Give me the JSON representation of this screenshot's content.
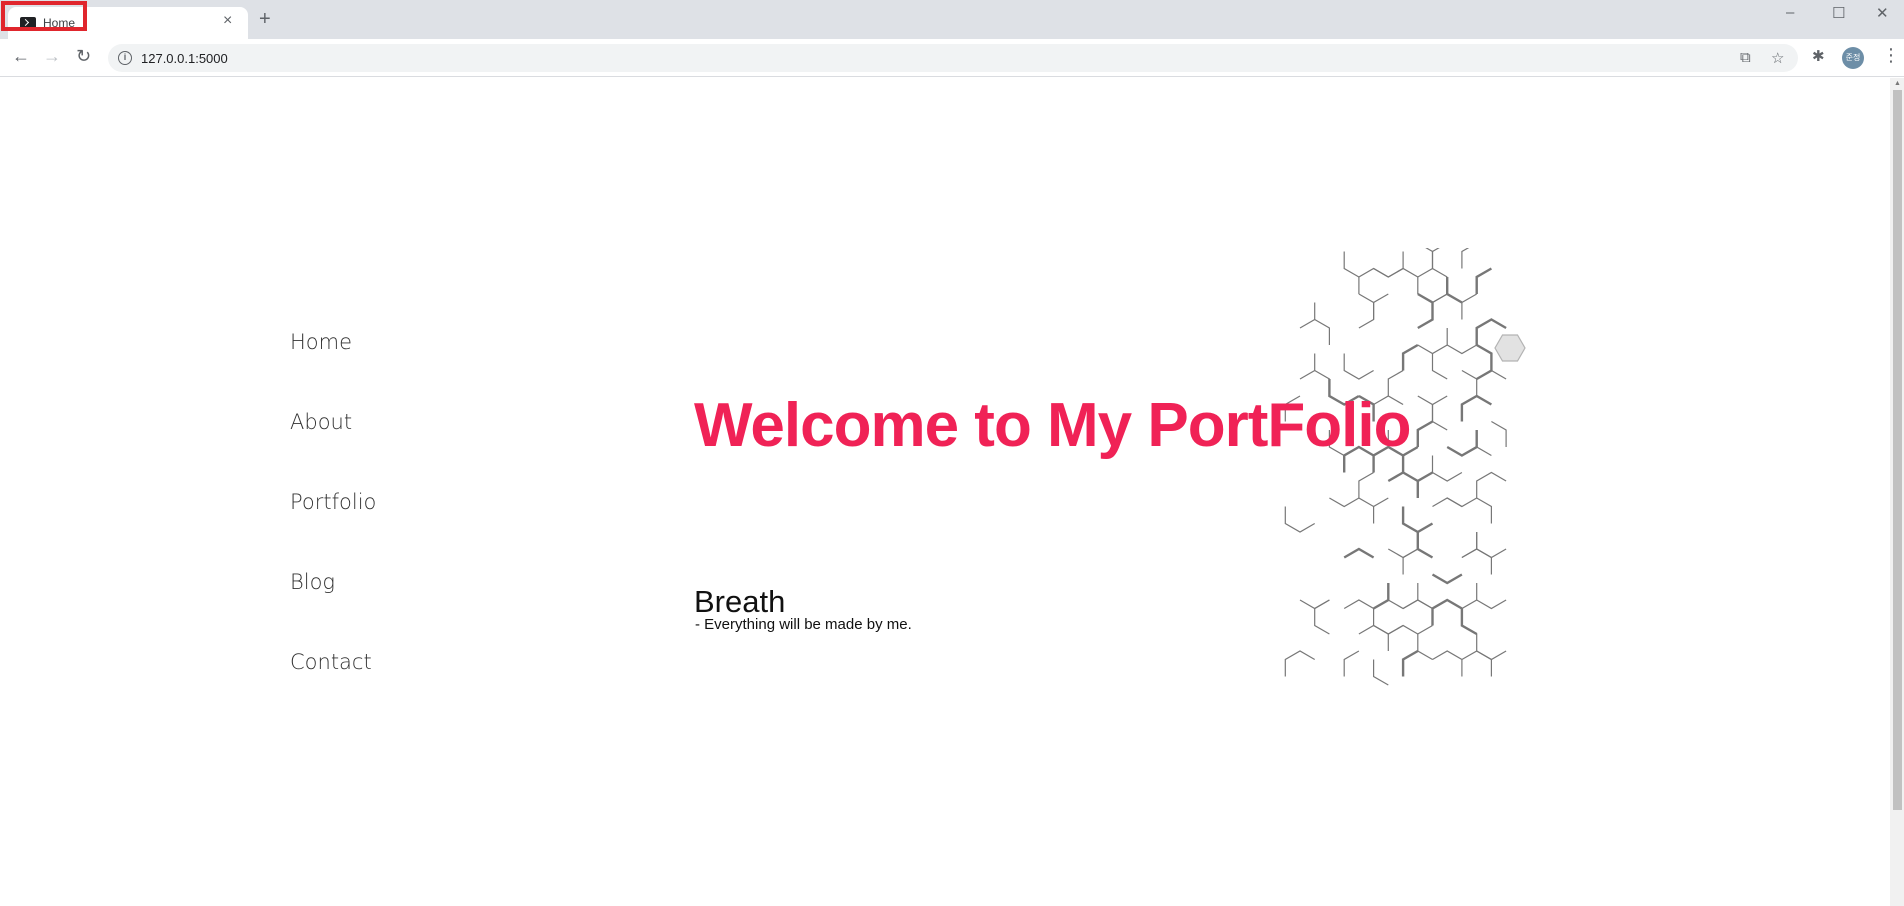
{
  "browser": {
    "tab_title": "Home",
    "tab_close": "×",
    "new_tab": "+",
    "url": "127.0.0.1:5000",
    "win_minimize": "–",
    "win_maximize": "☐",
    "win_close": "✕",
    "avatar_text": "준정"
  },
  "nav": {
    "items": [
      "Home",
      "About",
      "Portfolio",
      "Blog",
      "Contact"
    ]
  },
  "hero": {
    "title": "Welcome to My PortFolio",
    "subtitle": "Breath",
    "tagline": "- Everything will be made by me."
  },
  "colors": {
    "accent": "#f02256",
    "highlight_box": "#e0262d"
  }
}
